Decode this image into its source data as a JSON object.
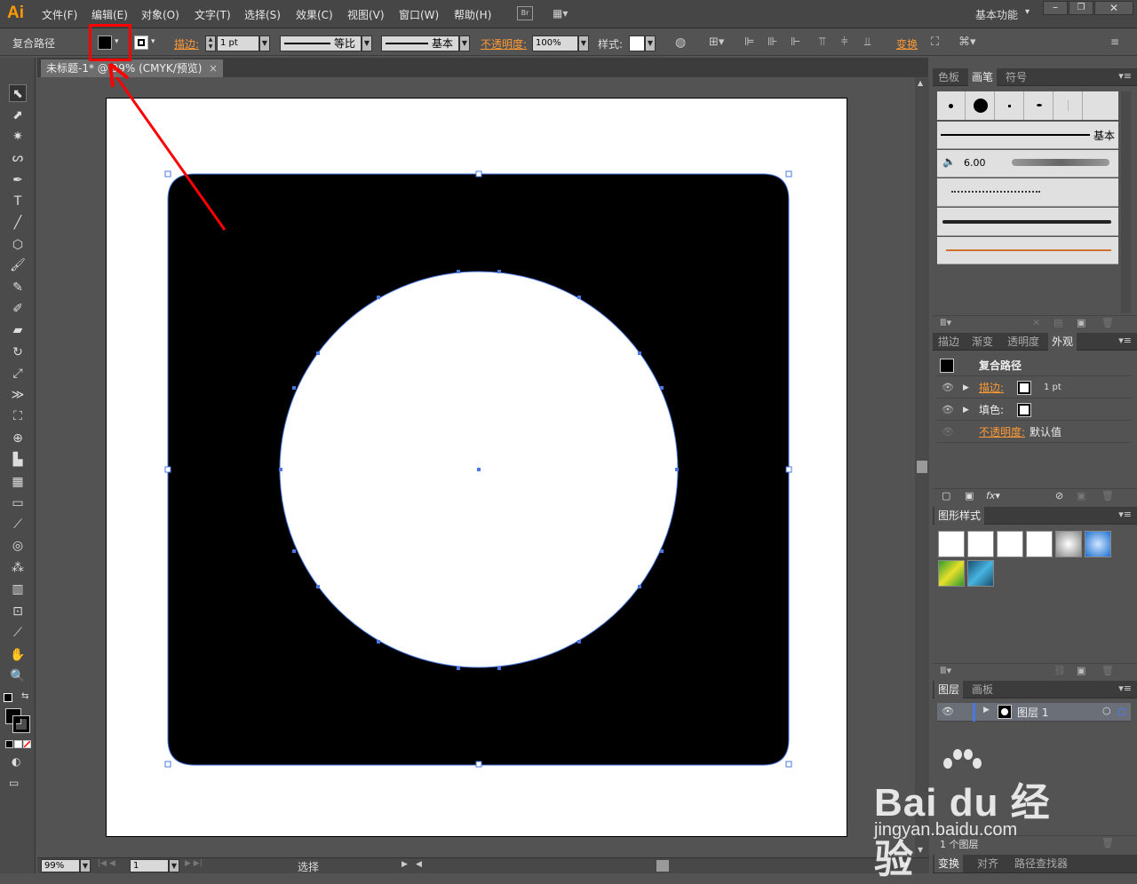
{
  "app": {
    "logo": "Ai",
    "workspace": "基本功能",
    "bridge": "Br"
  },
  "menu": [
    "文件(F)",
    "编辑(E)",
    "对象(O)",
    "文字(T)",
    "选择(S)",
    "效果(C)",
    "视图(V)",
    "窗口(W)",
    "帮助(H)"
  ],
  "control": {
    "object_type": "复合路径",
    "stroke_label": "描边:",
    "stroke_weight": "1 pt",
    "profile": "等比",
    "brush": "基本",
    "opacity_label": "不透明度:",
    "opacity": "100%",
    "style_label": "样式:",
    "transform_label": "变换"
  },
  "document": {
    "tab_title": "未标题-1* @ 99% (CMYK/预览)",
    "close": "×"
  },
  "colors": {
    "accent": "#ff9a00",
    "selection": "#4a78e0",
    "highlight": "#ff0000"
  },
  "panels": {
    "swatch_tabs": [
      "色板",
      "画笔",
      "符号"
    ],
    "brush_basic": "基本",
    "brush_size": "6.00",
    "appearance_tabs": [
      "描边",
      "渐变",
      "透明度",
      "外观"
    ],
    "appearance": {
      "title": "复合路径",
      "stroke_label": "描边:",
      "stroke_value": "1 pt",
      "fill_label": "填色:",
      "opacity_label": "不透明度:",
      "opacity_value": "默认值"
    },
    "graphic_styles_tab": "图形样式",
    "layers_tabs": [
      "图层",
      "画板"
    ],
    "layer_name": "图层 1",
    "layers_count": "1 个图层",
    "bottom_tabs": [
      "变换",
      "对齐",
      "路径查找器"
    ]
  },
  "status": {
    "zoom": "99%",
    "page": "1",
    "tool": "选择"
  },
  "watermark": {
    "brand": "Bai du 经验",
    "url": "jingyan.baidu.com"
  }
}
